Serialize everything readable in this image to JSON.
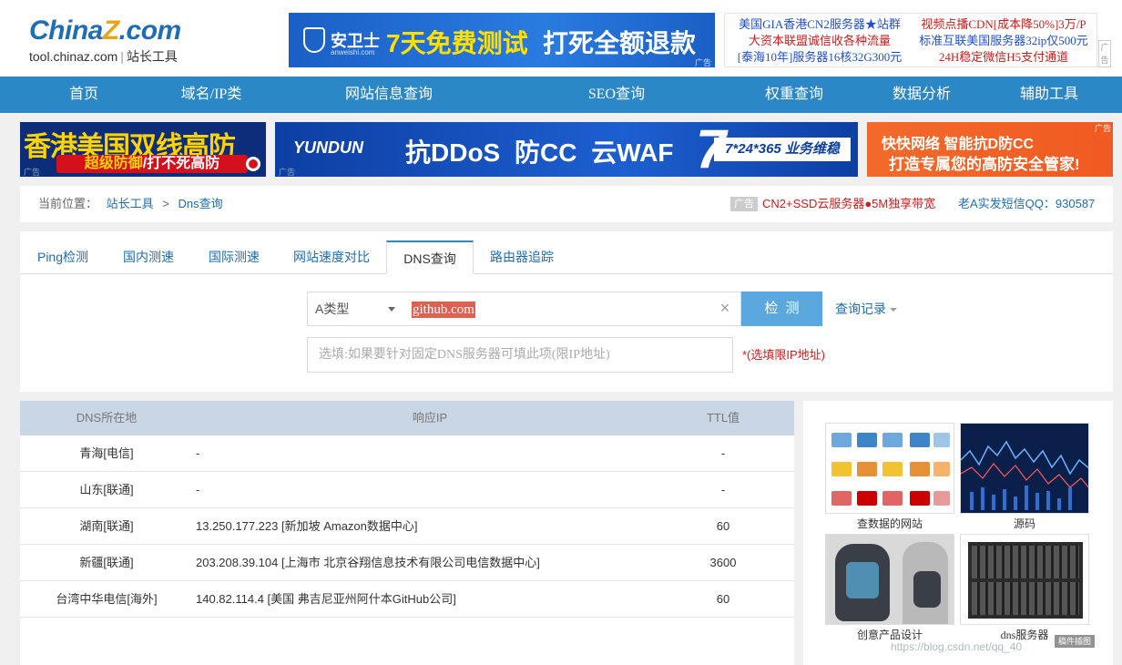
{
  "header": {
    "logo_main_a": "China",
    "logo_main_z": "Z",
    "logo_main_b": ".com",
    "logo_domain": "tool.chinaz.com",
    "logo_divider": "|",
    "logo_name": "站长工具",
    "banner_brand": "安卫士",
    "banner_brand_en": "anweishi.com",
    "banner_slogan_1": "7天免费测试",
    "banner_slogan_2": "打死全额退款",
    "ad_mark": "广告",
    "text_ads": {
      "col1": [
        "美国GIA香港CN2服务器★站群",
        "大资本联盟诚信收各种流量",
        "[泰海10年]服务器16核32G300元"
      ],
      "col2": [
        "视频点播CDN[成本降50%]3万/P",
        "标准互联美国服务器32ip仅500元",
        "24H稳定微信H5支付通道"
      ]
    },
    "side_tab": "广告"
  },
  "nav": [
    "首页",
    "域名/IP类",
    "网站信息查询",
    "SEO查询",
    "权重查询",
    "数据分析",
    "辅助工具"
  ],
  "ads_row": {
    "left_title": "香港美国双线高防",
    "left_sub_a": "超级防御",
    "left_sub_b": "/打不死高防",
    "mid_brand": "YUNDUN",
    "mid_main": "抗DDoS 防CC 云WAF",
    "mid_seven": "7",
    "mid_badge": "7*24*365 业务维稳",
    "right_line1": "快快网络  智能抗D防CC",
    "right_line2": "打造专属您的高防安全管家!",
    "ad_mark": "广告"
  },
  "breadcrumb": {
    "label": "当前位置：",
    "home": "站长工具",
    "sep": ">",
    "current": "Dns查询",
    "ad_label": "广告",
    "ad_text": "CN2+SSD云服务器●5M独享带宽",
    "qq_text": "老A实发短信QQ：930587"
  },
  "tabs": [
    "Ping检测",
    "国内测速",
    "国际测速",
    "网站速度对比",
    "DNS查询",
    "路由器追踪"
  ],
  "search": {
    "record_type": "A类型",
    "domain_value": "github.com",
    "clear_glyph": "×",
    "detect_label": "检测",
    "history_label": "查询记录",
    "dns_placeholder": "选填:如果要针对固定DNS服务器可填此项(限IP地址)",
    "dns_hint": "*(选填限IP地址)"
  },
  "table": {
    "headers": [
      "DNS所在地",
      "响应IP",
      "TTL值"
    ],
    "rows": [
      {
        "loc": "青海[电信]",
        "ip": "-",
        "ttl": "-"
      },
      {
        "loc": "山东[联通]",
        "ip": "-",
        "ttl": "-"
      },
      {
        "loc": "湖南[联通]",
        "ip": "13.250.177.223 [新加坡 Amazon数据中心]",
        "ttl": "60"
      },
      {
        "loc": "新疆[联通]",
        "ip": "203.208.39.104 [上海市 北京谷翔信息技术有限公司电信数据中心]",
        "ttl": "3600"
      },
      {
        "loc": "台湾中华电信[海外]",
        "ip": "140.82.114.4 [美国 弗吉尼亚州阿什本GitHub公司]",
        "ttl": "60"
      }
    ]
  },
  "sidebar": {
    "captions": [
      "查数据的网站",
      "源码",
      "创意产品设计",
      "dns服务器"
    ]
  },
  "watermark": "https://blog.csdn.net/qq_40",
  "watermark_box": "稿件插图"
}
